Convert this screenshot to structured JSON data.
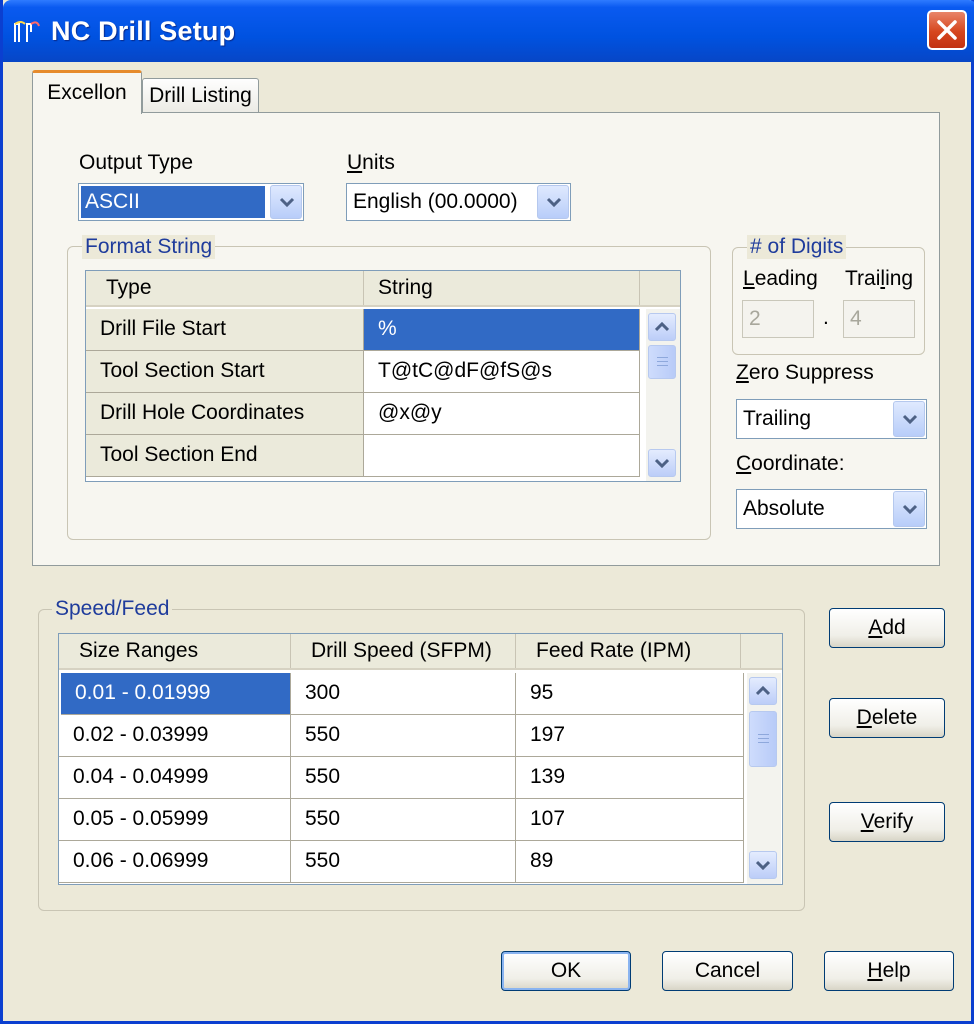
{
  "window": {
    "title": "NC Drill Setup"
  },
  "tabs": [
    {
      "label": "Excellon"
    },
    {
      "label": "Drill Listing"
    }
  ],
  "output_type": {
    "label": "Output Type",
    "value": "ASCII"
  },
  "units": {
    "label_u": "U",
    "label_rest": "nits",
    "value": "English (00.0000)"
  },
  "format_string": {
    "label": "Format String",
    "headers": [
      "Type",
      "String"
    ],
    "rows": [
      {
        "type": "Drill File Start",
        "string": "%"
      },
      {
        "type": "Tool Section Start",
        "string": "T@tC@dF@fS@s"
      },
      {
        "type": "Drill Hole Coordinates",
        "string": "@x@y"
      },
      {
        "type": "Tool Section End",
        "string": ""
      }
    ]
  },
  "digits": {
    "label": "# of Digits",
    "leading_label_u": "L",
    "leading_label_rest": "eading",
    "trailing_label_a": "Trai",
    "trailing_label_u": "l",
    "trailing_label_b": "ing",
    "leading": "2",
    "separator": ".",
    "trailing": "4"
  },
  "zero_suppress": {
    "label_u": "Z",
    "label_rest": "ero Suppress",
    "value": "Trailing"
  },
  "coordinate": {
    "label_u": "C",
    "label_rest": "oordinate:",
    "value": "Absolute"
  },
  "speed_feed": {
    "label": "Speed/Feed",
    "headers": [
      "Size Ranges",
      "Drill Speed (SFPM)",
      "Feed Rate (IPM)"
    ],
    "rows": [
      {
        "range": "0.01 - 0.01999",
        "speed": "300",
        "feed": "95"
      },
      {
        "range": "0.02 - 0.03999",
        "speed": "550",
        "feed": "197"
      },
      {
        "range": "0.04 - 0.04999",
        "speed": "550",
        "feed": "139"
      },
      {
        "range": "0.05 - 0.05999",
        "speed": "550",
        "feed": "107"
      },
      {
        "range": "0.06 - 0.06999",
        "speed": "550",
        "feed": "89"
      }
    ]
  },
  "buttons": {
    "add_u": "A",
    "add_rest": "dd",
    "delete_u": "D",
    "delete_rest": "elete",
    "verify_u": "V",
    "verify_rest": "erify",
    "ok": "OK",
    "cancel": "Cancel",
    "help_u": "H",
    "help_rest": "elp"
  },
  "colors": {
    "titlebar": "#0052e0",
    "selection": "#316ac5",
    "group_label": "#1f3c9c",
    "close_button": "#d6461e"
  }
}
